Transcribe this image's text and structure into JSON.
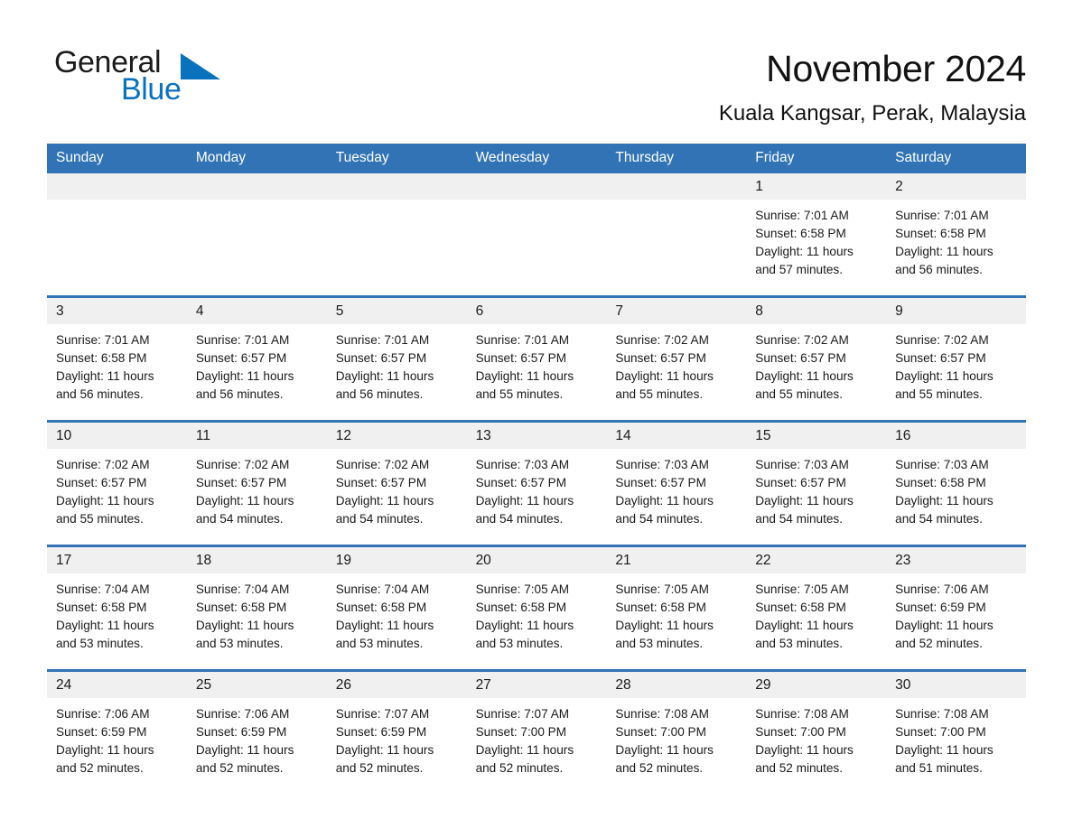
{
  "brand": {
    "name_part1": "General",
    "name_part2": "Blue",
    "flag_icon": "triangle-flag-icon"
  },
  "header": {
    "title": "November 2024",
    "location": "Kuala Kangsar, Perak, Malaysia"
  },
  "colors": {
    "header_blue": "#3173b4",
    "brand_blue": "#0a71bd",
    "date_strip_gray": "#f0f0f0",
    "text": "#1a1a1a"
  },
  "weekdays": [
    "Sunday",
    "Monday",
    "Tuesday",
    "Wednesday",
    "Thursday",
    "Friday",
    "Saturday"
  ],
  "weeks": [
    [
      {
        "day": "",
        "empty": true
      },
      {
        "day": "",
        "empty": true
      },
      {
        "day": "",
        "empty": true
      },
      {
        "day": "",
        "empty": true
      },
      {
        "day": "",
        "empty": true
      },
      {
        "day": "1",
        "sunrise": "Sunrise: 7:01 AM",
        "sunset": "Sunset: 6:58 PM",
        "daylight1": "Daylight: 11 hours",
        "daylight2": "and 57 minutes."
      },
      {
        "day": "2",
        "sunrise": "Sunrise: 7:01 AM",
        "sunset": "Sunset: 6:58 PM",
        "daylight1": "Daylight: 11 hours",
        "daylight2": "and 56 minutes."
      }
    ],
    [
      {
        "day": "3",
        "sunrise": "Sunrise: 7:01 AM",
        "sunset": "Sunset: 6:58 PM",
        "daylight1": "Daylight: 11 hours",
        "daylight2": "and 56 minutes."
      },
      {
        "day": "4",
        "sunrise": "Sunrise: 7:01 AM",
        "sunset": "Sunset: 6:57 PM",
        "daylight1": "Daylight: 11 hours",
        "daylight2": "and 56 minutes."
      },
      {
        "day": "5",
        "sunrise": "Sunrise: 7:01 AM",
        "sunset": "Sunset: 6:57 PM",
        "daylight1": "Daylight: 11 hours",
        "daylight2": "and 56 minutes."
      },
      {
        "day": "6",
        "sunrise": "Sunrise: 7:01 AM",
        "sunset": "Sunset: 6:57 PM",
        "daylight1": "Daylight: 11 hours",
        "daylight2": "and 55 minutes."
      },
      {
        "day": "7",
        "sunrise": "Sunrise: 7:02 AM",
        "sunset": "Sunset: 6:57 PM",
        "daylight1": "Daylight: 11 hours",
        "daylight2": "and 55 minutes."
      },
      {
        "day": "8",
        "sunrise": "Sunrise: 7:02 AM",
        "sunset": "Sunset: 6:57 PM",
        "daylight1": "Daylight: 11 hours",
        "daylight2": "and 55 minutes."
      },
      {
        "day": "9",
        "sunrise": "Sunrise: 7:02 AM",
        "sunset": "Sunset: 6:57 PM",
        "daylight1": "Daylight: 11 hours",
        "daylight2": "and 55 minutes."
      }
    ],
    [
      {
        "day": "10",
        "sunrise": "Sunrise: 7:02 AM",
        "sunset": "Sunset: 6:57 PM",
        "daylight1": "Daylight: 11 hours",
        "daylight2": "and 55 minutes."
      },
      {
        "day": "11",
        "sunrise": "Sunrise: 7:02 AM",
        "sunset": "Sunset: 6:57 PM",
        "daylight1": "Daylight: 11 hours",
        "daylight2": "and 54 minutes."
      },
      {
        "day": "12",
        "sunrise": "Sunrise: 7:02 AM",
        "sunset": "Sunset: 6:57 PM",
        "daylight1": "Daylight: 11 hours",
        "daylight2": "and 54 minutes."
      },
      {
        "day": "13",
        "sunrise": "Sunrise: 7:03 AM",
        "sunset": "Sunset: 6:57 PM",
        "daylight1": "Daylight: 11 hours",
        "daylight2": "and 54 minutes."
      },
      {
        "day": "14",
        "sunrise": "Sunrise: 7:03 AM",
        "sunset": "Sunset: 6:57 PM",
        "daylight1": "Daylight: 11 hours",
        "daylight2": "and 54 minutes."
      },
      {
        "day": "15",
        "sunrise": "Sunrise: 7:03 AM",
        "sunset": "Sunset: 6:57 PM",
        "daylight1": "Daylight: 11 hours",
        "daylight2": "and 54 minutes."
      },
      {
        "day": "16",
        "sunrise": "Sunrise: 7:03 AM",
        "sunset": "Sunset: 6:58 PM",
        "daylight1": "Daylight: 11 hours",
        "daylight2": "and 54 minutes."
      }
    ],
    [
      {
        "day": "17",
        "sunrise": "Sunrise: 7:04 AM",
        "sunset": "Sunset: 6:58 PM",
        "daylight1": "Daylight: 11 hours",
        "daylight2": "and 53 minutes."
      },
      {
        "day": "18",
        "sunrise": "Sunrise: 7:04 AM",
        "sunset": "Sunset: 6:58 PM",
        "daylight1": "Daylight: 11 hours",
        "daylight2": "and 53 minutes."
      },
      {
        "day": "19",
        "sunrise": "Sunrise: 7:04 AM",
        "sunset": "Sunset: 6:58 PM",
        "daylight1": "Daylight: 11 hours",
        "daylight2": "and 53 minutes."
      },
      {
        "day": "20",
        "sunrise": "Sunrise: 7:05 AM",
        "sunset": "Sunset: 6:58 PM",
        "daylight1": "Daylight: 11 hours",
        "daylight2": "and 53 minutes."
      },
      {
        "day": "21",
        "sunrise": "Sunrise: 7:05 AM",
        "sunset": "Sunset: 6:58 PM",
        "daylight1": "Daylight: 11 hours",
        "daylight2": "and 53 minutes."
      },
      {
        "day": "22",
        "sunrise": "Sunrise: 7:05 AM",
        "sunset": "Sunset: 6:58 PM",
        "daylight1": "Daylight: 11 hours",
        "daylight2": "and 53 minutes."
      },
      {
        "day": "23",
        "sunrise": "Sunrise: 7:06 AM",
        "sunset": "Sunset: 6:59 PM",
        "daylight1": "Daylight: 11 hours",
        "daylight2": "and 52 minutes."
      }
    ],
    [
      {
        "day": "24",
        "sunrise": "Sunrise: 7:06 AM",
        "sunset": "Sunset: 6:59 PM",
        "daylight1": "Daylight: 11 hours",
        "daylight2": "and 52 minutes."
      },
      {
        "day": "25",
        "sunrise": "Sunrise: 7:06 AM",
        "sunset": "Sunset: 6:59 PM",
        "daylight1": "Daylight: 11 hours",
        "daylight2": "and 52 minutes."
      },
      {
        "day": "26",
        "sunrise": "Sunrise: 7:07 AM",
        "sunset": "Sunset: 6:59 PM",
        "daylight1": "Daylight: 11 hours",
        "daylight2": "and 52 minutes."
      },
      {
        "day": "27",
        "sunrise": "Sunrise: 7:07 AM",
        "sunset": "Sunset: 7:00 PM",
        "daylight1": "Daylight: 11 hours",
        "daylight2": "and 52 minutes."
      },
      {
        "day": "28",
        "sunrise": "Sunrise: 7:08 AM",
        "sunset": "Sunset: 7:00 PM",
        "daylight1": "Daylight: 11 hours",
        "daylight2": "and 52 minutes."
      },
      {
        "day": "29",
        "sunrise": "Sunrise: 7:08 AM",
        "sunset": "Sunset: 7:00 PM",
        "daylight1": "Daylight: 11 hours",
        "daylight2": "and 52 minutes."
      },
      {
        "day": "30",
        "sunrise": "Sunrise: 7:08 AM",
        "sunset": "Sunset: 7:00 PM",
        "daylight1": "Daylight: 11 hours",
        "daylight2": "and 51 minutes."
      }
    ]
  ]
}
